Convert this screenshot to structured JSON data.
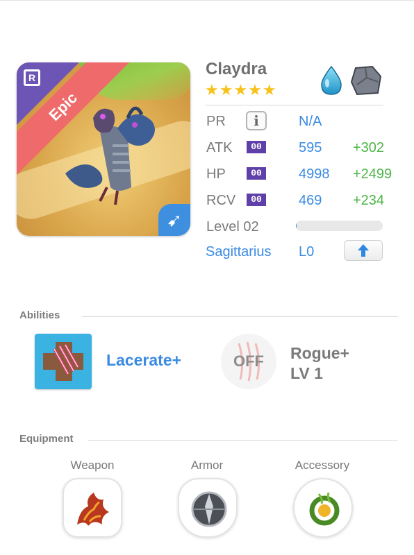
{
  "monster": {
    "name": "Claydra",
    "stars": "★★★★★",
    "rarity": "Epic",
    "rarity_badge": "R",
    "elements": [
      "water-drop-icon",
      "stone-icon"
    ],
    "sign_icon": "sagittarius-arrow-icon"
  },
  "stats": {
    "pr": {
      "label": "PR",
      "value": "N/A"
    },
    "atk": {
      "label": "ATK",
      "badge": "00",
      "value": "595",
      "bonus": "+302"
    },
    "hp": {
      "label": "HP",
      "badge": "00",
      "value": "4998",
      "bonus": "+2499"
    },
    "rcv": {
      "label": "RCV",
      "badge": "00",
      "value": "469",
      "bonus": "+234"
    },
    "level": {
      "label": "Level 02",
      "progress_fraction": 0.01
    },
    "sign": {
      "label": "Sagittarius",
      "value": "L0"
    }
  },
  "abilities": {
    "title": "Abilities",
    "active": {
      "name": "Lacerate+"
    },
    "passive": {
      "state": "OFF",
      "name": "Rogue+",
      "level": "LV 1"
    }
  },
  "equipment": {
    "title": "Equipment",
    "slots": [
      {
        "label": "Weapon",
        "icon": "weapon-icon"
      },
      {
        "label": "Armor",
        "icon": "armor-icon"
      },
      {
        "label": "Accessory",
        "icon": "accessory-icon"
      }
    ]
  },
  "colors": {
    "accent_blue": "#3b8be2",
    "bonus_green": "#4db548",
    "epic_red": "#ef6a6a",
    "rarity_purple": "#6c55b5",
    "star_yellow": "#f7c21a"
  }
}
